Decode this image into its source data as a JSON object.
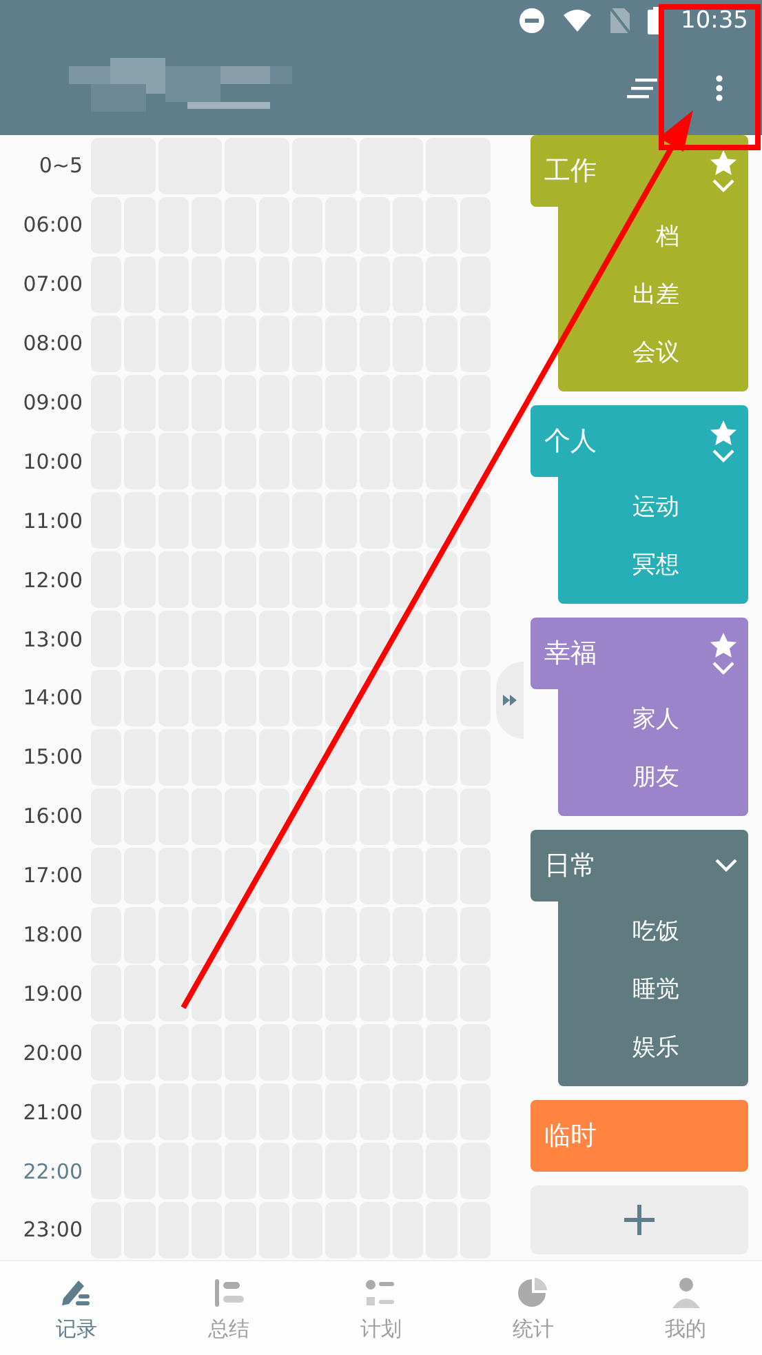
{
  "status_bar": {
    "time": "10:35"
  },
  "timeline": [
    {
      "label": "0~5",
      "kind": "night",
      "current": false
    },
    {
      "label": "06:00",
      "kind": "hour",
      "current": false
    },
    {
      "label": "07:00",
      "kind": "hour",
      "current": false
    },
    {
      "label": "08:00",
      "kind": "hour",
      "current": false
    },
    {
      "label": "09:00",
      "kind": "hour",
      "current": false
    },
    {
      "label": "10:00",
      "kind": "hour",
      "current": false
    },
    {
      "label": "11:00",
      "kind": "hour",
      "current": false
    },
    {
      "label": "12:00",
      "kind": "hour",
      "current": false
    },
    {
      "label": "13:00",
      "kind": "hour",
      "current": false
    },
    {
      "label": "14:00",
      "kind": "hour",
      "current": false
    },
    {
      "label": "15:00",
      "kind": "hour",
      "current": false
    },
    {
      "label": "16:00",
      "kind": "hour",
      "current": false
    },
    {
      "label": "17:00",
      "kind": "hour",
      "current": false
    },
    {
      "label": "18:00",
      "kind": "hour",
      "current": false
    },
    {
      "label": "19:00",
      "kind": "hour",
      "current": false
    },
    {
      "label": "20:00",
      "kind": "hour",
      "current": false
    },
    {
      "label": "21:00",
      "kind": "hour",
      "current": false
    },
    {
      "label": "22:00",
      "kind": "hour",
      "current": true
    },
    {
      "label": "23:00",
      "kind": "hour",
      "current": false
    }
  ],
  "categories": [
    {
      "name": "工作",
      "color": "#a8b22a",
      "starred": true,
      "children": [
        "档",
        "出差",
        "会议"
      ]
    },
    {
      "name": "个人",
      "color": "#26afb7",
      "starred": true,
      "children": [
        "运动",
        "冥想"
      ]
    },
    {
      "name": "幸福",
      "color": "#9b84c9",
      "starred": true,
      "children": [
        "家人",
        "朋友"
      ]
    },
    {
      "name": "日常",
      "color": "#5f7b80",
      "starred": false,
      "children": [
        "吃饭",
        "睡觉",
        "娱乐"
      ]
    },
    {
      "name": "临时",
      "color": "#ff8440"
    }
  ],
  "bottom_nav": [
    {
      "label": "记录",
      "selected": true,
      "kind": "record"
    },
    {
      "label": "总结",
      "selected": false,
      "kind": "summary"
    },
    {
      "label": "计划",
      "selected": false,
      "kind": "plan"
    },
    {
      "label": "统计",
      "selected": false,
      "kind": "stats"
    },
    {
      "label": "我的",
      "selected": false,
      "kind": "me"
    }
  ]
}
